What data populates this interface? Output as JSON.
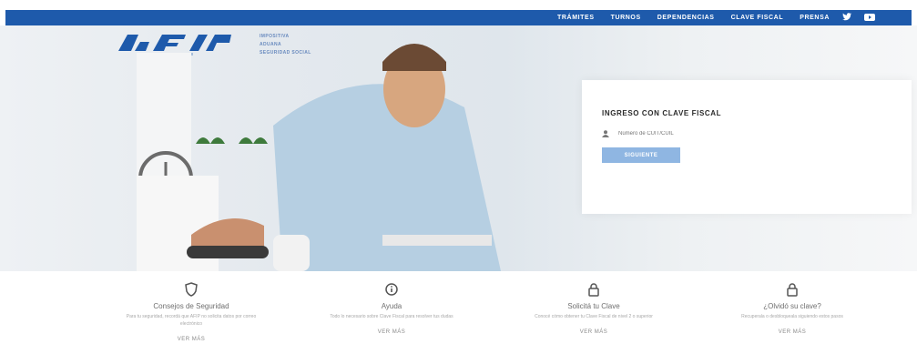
{
  "nav": {
    "items": [
      "TRÁMITES",
      "TURNOS",
      "DEPENDENCIAS",
      "CLAVE FISCAL",
      "PRENSA"
    ],
    "social_icons": [
      "twitter-icon",
      "youtube-icon"
    ]
  },
  "brand": {
    "logo": "AFIP",
    "departments": [
      "IMPOSITIVA",
      "ADUANA",
      "SEGURIDAD SOCIAL"
    ]
  },
  "login": {
    "title": "INGRESO CON CLAVE FISCAL",
    "cuit_placeholder": "Número de CUIT/CUIL",
    "submit_label": "SIGUIENTE",
    "user_icon": "user-icon"
  },
  "features": [
    {
      "icon": "shield-icon",
      "title": "Consejos de Seguridad",
      "description": "Para tu seguridad, recordá que AFIP no solicita datos por correo electrónico",
      "link": "VER MÁS"
    },
    {
      "icon": "info-icon",
      "title": "Ayuda",
      "description": "Todo lo necesario sobre Clave Fiscal para resolver tus dudas",
      "link": "VER MÁS"
    },
    {
      "icon": "lock-icon",
      "title": "Solicitá tu Clave",
      "description": "Conocé cómo obtener tu Clave Fiscal de nivel 2 o superior",
      "link": "VER MÁS"
    },
    {
      "icon": "lock-icon",
      "title": "¿Olvidó su clave?",
      "description": "Recuperala o desbloqueala siguiendo estos pasos",
      "link": "VER MÁS"
    }
  ]
}
